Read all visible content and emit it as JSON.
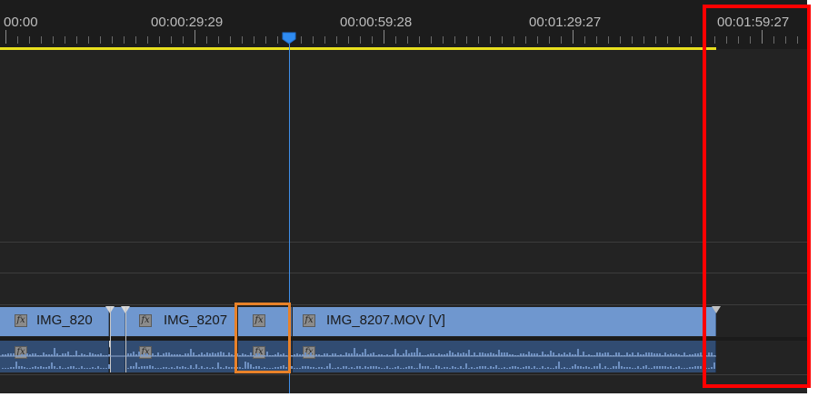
{
  "ruler": {
    "timecodes": [
      "00:00",
      "00:00:29:29",
      "00:00:59:28",
      "00:01:29:27",
      "00:01:59:27"
    ]
  },
  "video_track": {
    "clips": [
      {
        "label": "IMG_820"
      },
      {
        "label": "IMG_8207"
      },
      {
        "label": ""
      },
      {
        "label": "IMG_8207.MOV [V]"
      }
    ]
  },
  "icons": {
    "fx": "fx"
  },
  "colors": {
    "panel_bg": "#232323",
    "video_clip": "#6f97cf",
    "audio_clip": "#314c72",
    "playhead": "#3f8ee8",
    "work_area_bar": "#e8df1e",
    "highlight_red": "#ff0000",
    "highlight_orange": "#e8822a"
  }
}
